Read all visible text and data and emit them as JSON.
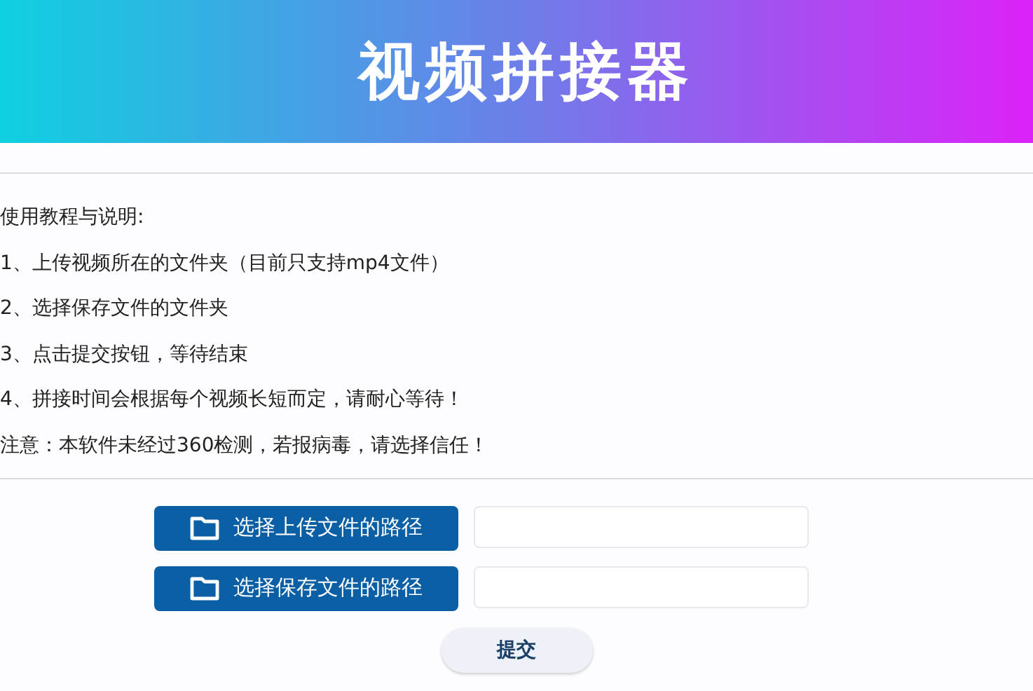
{
  "header": {
    "title": "视频拼接器"
  },
  "instructions": [
    "使用教程与说明:",
    "1、上传视频所在的文件夹（目前只支持mp4文件）",
    "2、选择保存文件的文件夹",
    "3、点击提交按钮，等待结束",
    "4、拼接时间会根据每个视频长短而定，请耐心等待！",
    "注意：本软件未经过360检测，若报病毒，请选择信任！"
  ],
  "path_rows": [
    {
      "button": "选择上传文件的路径"
    },
    {
      "button": "选择保存文件的路径"
    }
  ],
  "submit": "提交"
}
